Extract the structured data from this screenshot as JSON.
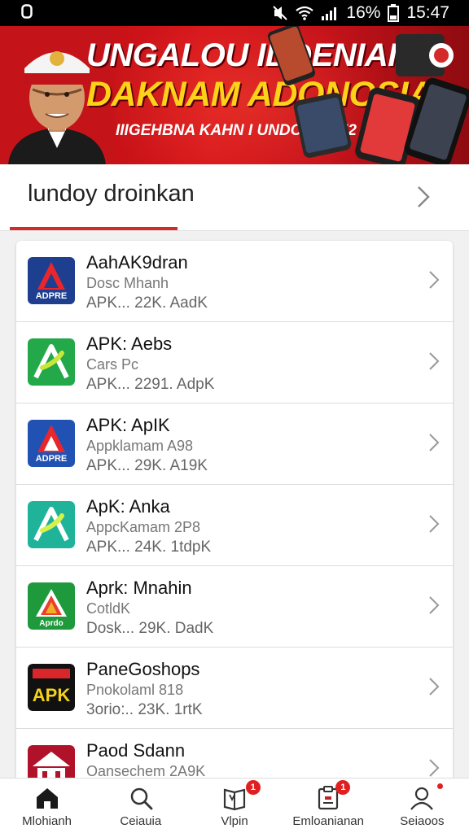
{
  "status_bar": {
    "left_icon": "notification-icon",
    "battery_percent": "16%",
    "time": "15:47"
  },
  "banner": {
    "line1": "UNGALOU IDDENIAIN",
    "line2": "DAKNAM ADONOSIA",
    "line3": "IIIGEHBNA KAHN I UNDORNSIII2",
    "accent_color": "#d8161c",
    "highlight_color": "#ffd21a"
  },
  "section": {
    "title": "lundoy droinkan"
  },
  "apps": [
    {
      "name": "AahAK9dran",
      "sub": "Dosc Mhanh",
      "meta": "APK... 22K. AadK",
      "icon_label": "ADPRE",
      "icon": "app-logo-red-blue"
    },
    {
      "name": "APK: Aebs",
      "sub": "Cars Pc",
      "meta": "APK... 2291. AdpK",
      "icon_label": "",
      "icon": "app-logo-green"
    },
    {
      "name": "APK: ApIK",
      "sub": "Appklamam A98",
      "meta": "APK... 29K. A19K",
      "icon_label": "ADPRE",
      "icon": "app-logo-red-blue"
    },
    {
      "name": "ApK: Anka",
      "sub": "AppcKamam 2P8",
      "meta": "APK... 24K. 1tdpK",
      "icon_label": "",
      "icon": "app-logo-teal"
    },
    {
      "name": "Aprk: Mnahin",
      "sub": "CotldK",
      "meta": "Dosk... 29K. DadK",
      "icon_label": "Aprdo",
      "icon": "app-logo-green-triangle"
    },
    {
      "name": "PaneGoshops",
      "sub": "Pnokolaml 818",
      "meta": "3orio:.. 23K. 1rtK",
      "icon_label": "APK",
      "icon": "app-logo-black-yellow"
    },
    {
      "name": "Paod Sdann",
      "sub": "Oansechem 2A9K",
      "meta": "",
      "icon_label": "",
      "icon": "app-logo-house"
    }
  ],
  "nav": [
    {
      "label": "Mlohianh",
      "icon": "home-icon",
      "badge": ""
    },
    {
      "label": "Ceiauia",
      "icon": "search-icon",
      "badge": ""
    },
    {
      "label": "Vlpin",
      "icon": "book-icon",
      "badge": "1"
    },
    {
      "label": "Emloanianan",
      "icon": "clipboard-icon",
      "badge": "1"
    },
    {
      "label": "Seiaoos",
      "icon": "profile-icon",
      "badge": "dot"
    }
  ]
}
